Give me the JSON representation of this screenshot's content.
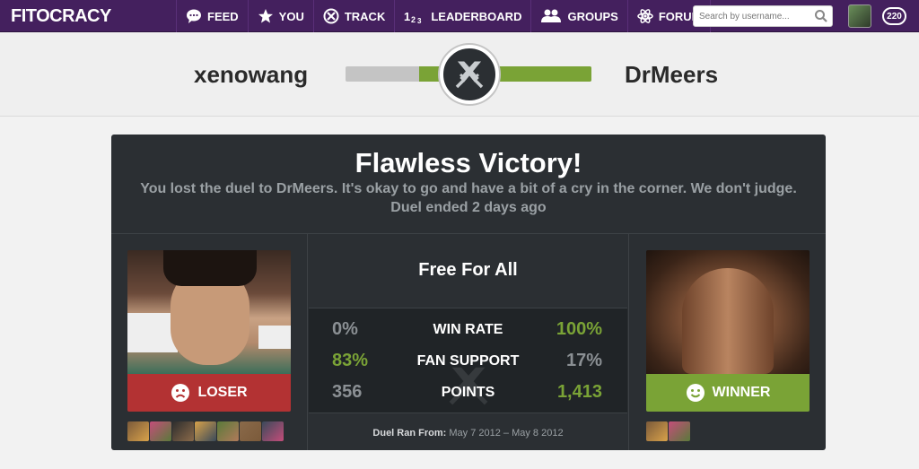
{
  "nav": {
    "logo": "FITOCRACY",
    "items": [
      {
        "label": "FEED",
        "icon": "chat-bubble-icon"
      },
      {
        "label": "YOU",
        "icon": "star-icon"
      },
      {
        "label": "TRACK",
        "icon": "track-icon"
      },
      {
        "label": "LEADERBOARD",
        "icon": "leaderboard-123-icon"
      },
      {
        "label": "GROUPS",
        "icon": "groups-icon"
      },
      {
        "label": "FORUM",
        "icon": "atom-icon"
      }
    ],
    "search_placeholder": "Search by username...",
    "badge_count": "220"
  },
  "duel": {
    "left_user": "xenowang",
    "right_user": "DrMeers",
    "progress_right_fraction": 0.7
  },
  "result": {
    "title": "Flawless Victory!",
    "subtitle": "You lost the duel to DrMeers. It's okay to go and have a bit of a cry in the corner. We don't judge.",
    "ended": "Duel ended 2 days ago",
    "mode": "Free For All",
    "loser_label": "LOSER",
    "winner_label": "WINNER",
    "stats": [
      {
        "label": "WIN RATE",
        "left": "0%",
        "right": "100%",
        "left_color": "gray",
        "right_color": "green"
      },
      {
        "label": "FAN SUPPORT",
        "left": "83%",
        "right": "17%",
        "left_color": "green",
        "right_color": "gray"
      },
      {
        "label": "POINTS",
        "left": "356",
        "right": "1,413",
        "left_color": "gray",
        "right_color": "green"
      }
    ],
    "ran_label": "Duel Ran From:",
    "ran_dates": "May 7 2012 – May 8 2012",
    "loser_fans": 7,
    "winner_fans": 2
  },
  "colors": {
    "nav_bg": "#44205e",
    "panel_bg": "#2b2f33",
    "green": "#7aa336",
    "red": "#b33233"
  }
}
